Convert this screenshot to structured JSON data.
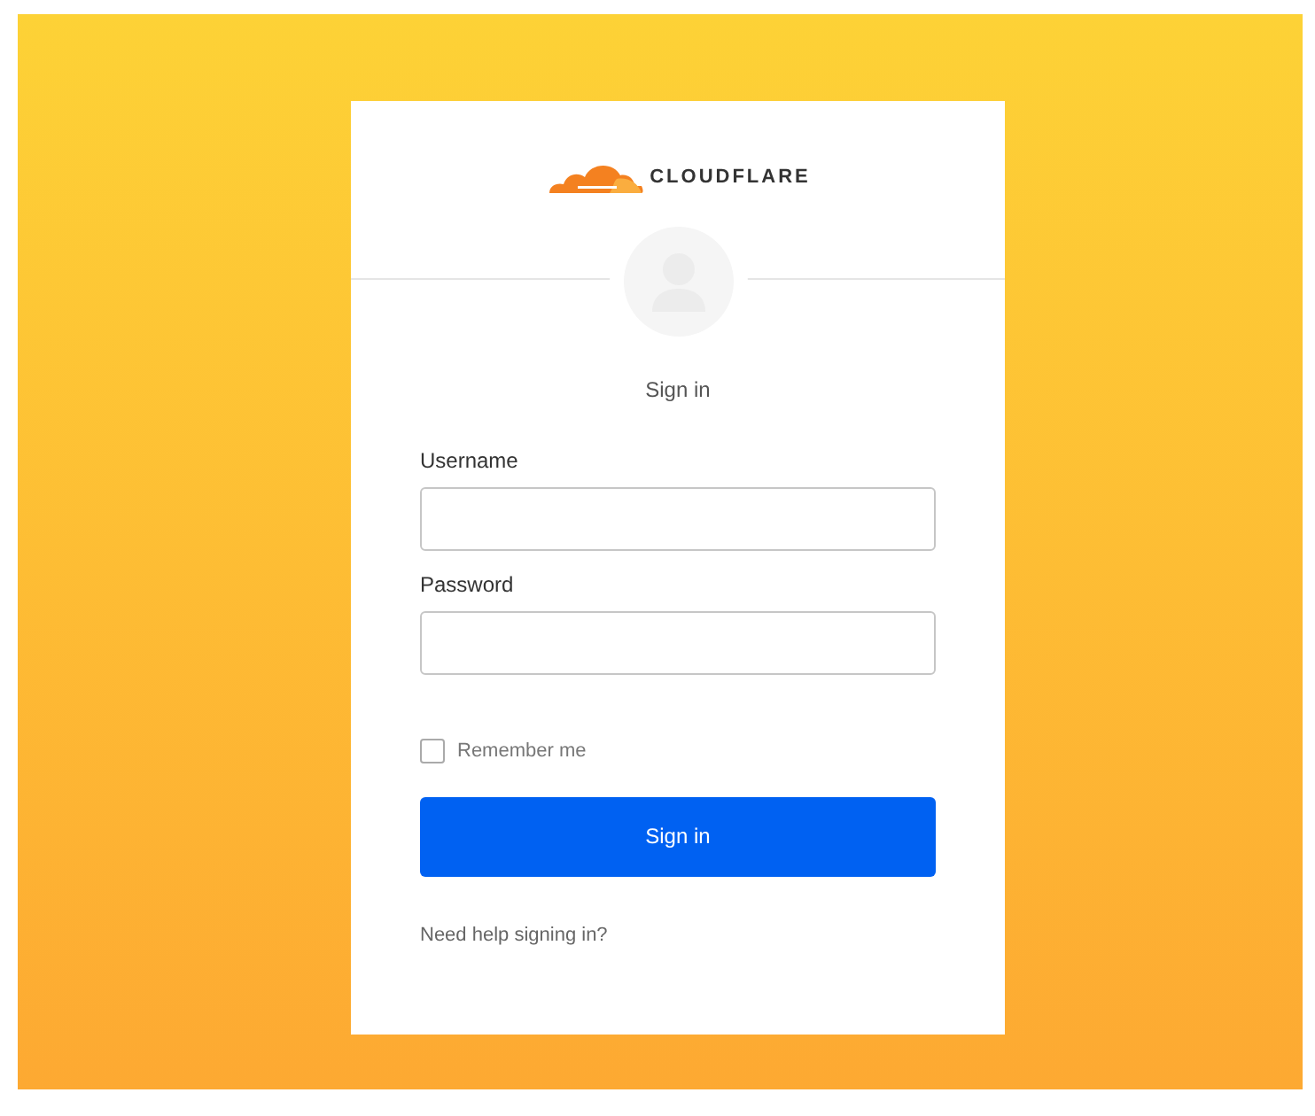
{
  "logo": {
    "text": "CLOUDFLARE"
  },
  "heading": "Sign in",
  "fields": [
    {
      "label": "Username"
    },
    {
      "label": "Password"
    }
  ],
  "remember": {
    "label": "Remember me",
    "checked": false
  },
  "button": "Sign in",
  "help_link": "Need help signing in?"
}
